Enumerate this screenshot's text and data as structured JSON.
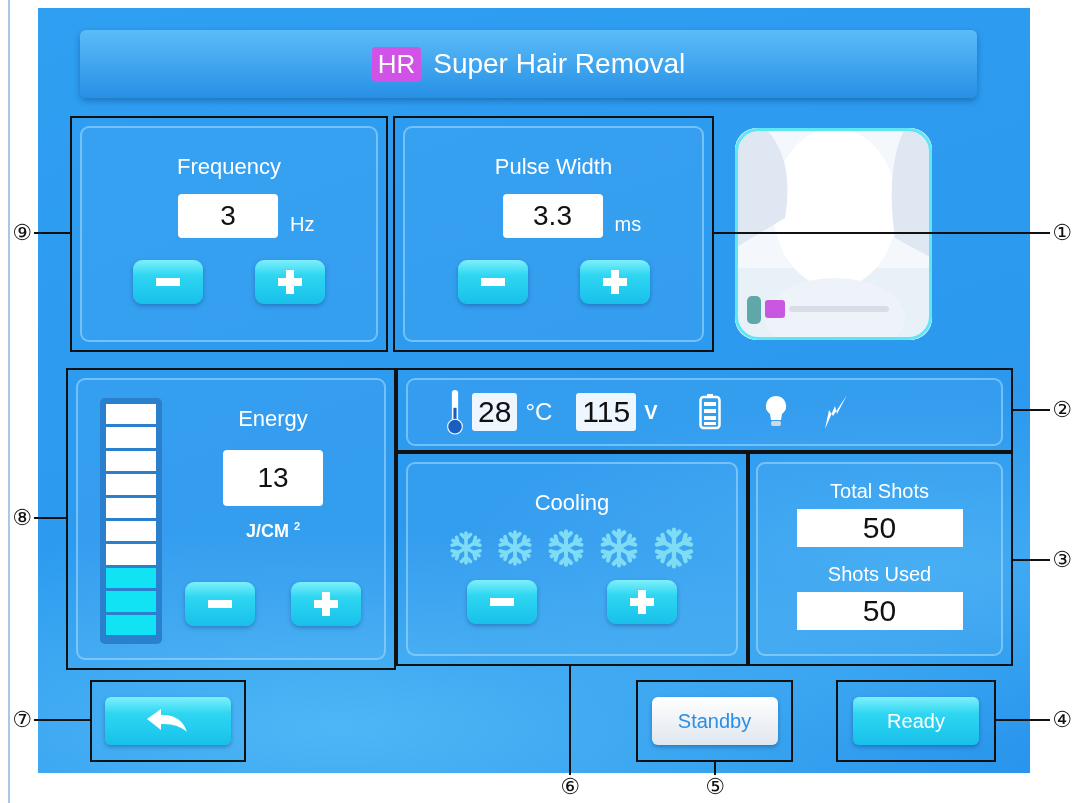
{
  "header": {
    "badge": "HR",
    "title": "Super Hair Removal"
  },
  "frequency": {
    "label": "Frequency",
    "value": "3",
    "unit": "Hz"
  },
  "pulse_width": {
    "label": "Pulse Width",
    "value": "3.3",
    "unit": "ms"
  },
  "energy": {
    "label": "Energy",
    "value": "13",
    "unit": "J/CM $^{2}$",
    "level": 0.3
  },
  "status": {
    "temperature": "28",
    "temperature_unit": "°C",
    "voltage": "115",
    "voltage_unit": "V"
  },
  "cooling": {
    "label": "Cooling"
  },
  "shots": {
    "total_label": "Total Shots",
    "total": "50",
    "used_label": "Shots Used",
    "used": "50"
  },
  "buttons": [
    {
      "kind": "back"
    },
    {
      "kind": "standby",
      "label": "Standby"
    },
    {
      "kind": "ready",
      "label": "Ready"
    }
  ],
  "callouts": [
    {
      "number": "⑨"
    },
    {
      "number": "①"
    },
    {
      "number": "②"
    },
    {
      "number": "⑧"
    },
    {
      "number": "③"
    },
    {
      "number": "⑦"
    },
    {
      "number": "④"
    },
    {
      "number": "⑥"
    },
    {
      "number": "⑤"
    }
  ]
}
